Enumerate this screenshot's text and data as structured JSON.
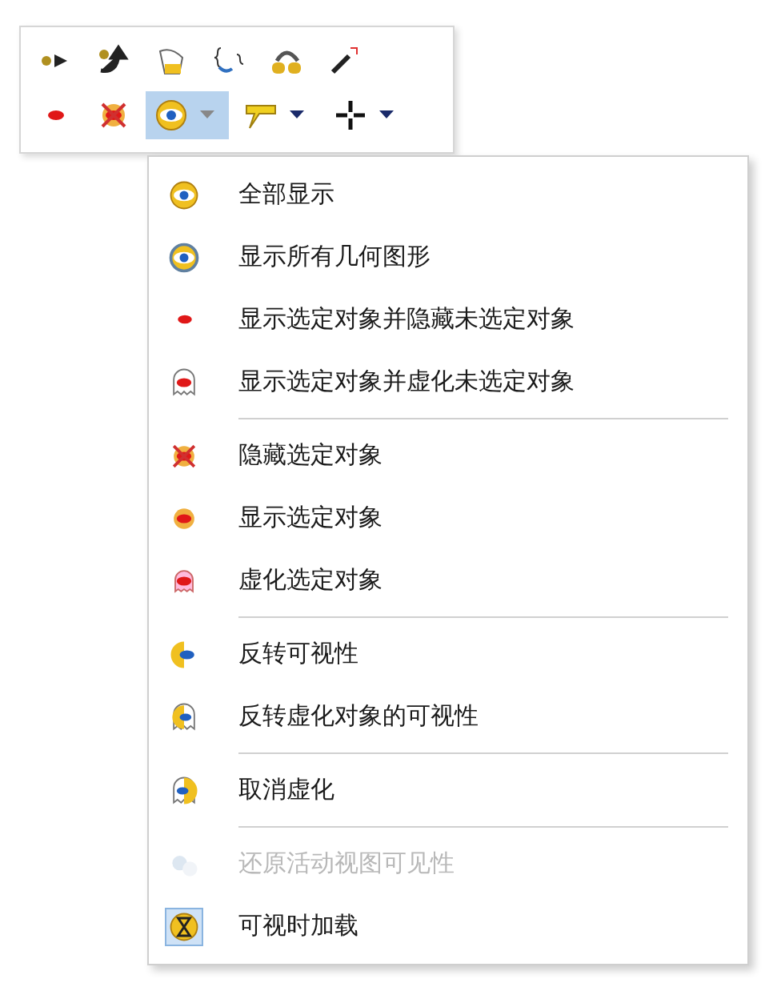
{
  "toolbar": {
    "rows": [
      [
        {
          "kind": "plain",
          "selected": false
        },
        {
          "kind": "plain",
          "selected": false
        },
        {
          "kind": "plain",
          "selected": false
        },
        {
          "kind": "plain",
          "selected": false
        },
        {
          "kind": "plain",
          "selected": false
        },
        {
          "kind": "plain",
          "selected": false
        }
      ],
      [
        {
          "kind": "plain",
          "selected": false
        },
        {
          "kind": "plain",
          "selected": false
        },
        {
          "kind": "split",
          "selected": true
        },
        {
          "kind": "split",
          "selected": false
        },
        {
          "kind": "split",
          "selected": false
        }
      ]
    ]
  },
  "menu": {
    "groups": [
      [
        {
          "label": "全部显示",
          "disabled": false,
          "checked": false
        },
        {
          "label": "显示所有几何图形",
          "disabled": false,
          "checked": false
        },
        {
          "label": "显示选定对象并隐藏未选定对象",
          "disabled": false,
          "checked": false
        },
        {
          "label": "显示选定对象并虚化未选定对象",
          "disabled": false,
          "checked": false
        }
      ],
      [
        {
          "label": "隐藏选定对象",
          "disabled": false,
          "checked": false
        },
        {
          "label": "显示选定对象",
          "disabled": false,
          "checked": false
        },
        {
          "label": "虚化选定对象",
          "disabled": false,
          "checked": false
        }
      ],
      [
        {
          "label": "反转可视性",
          "disabled": false,
          "checked": false
        },
        {
          "label": "反转虚化对象的可视性",
          "disabled": false,
          "checked": false
        }
      ],
      [
        {
          "label": "取消虚化",
          "disabled": false,
          "checked": false
        }
      ],
      [
        {
          "label": "还原活动视图可见性",
          "disabled": true,
          "checked": false
        },
        {
          "label": "可视时加载",
          "disabled": false,
          "checked": true
        }
      ]
    ]
  }
}
